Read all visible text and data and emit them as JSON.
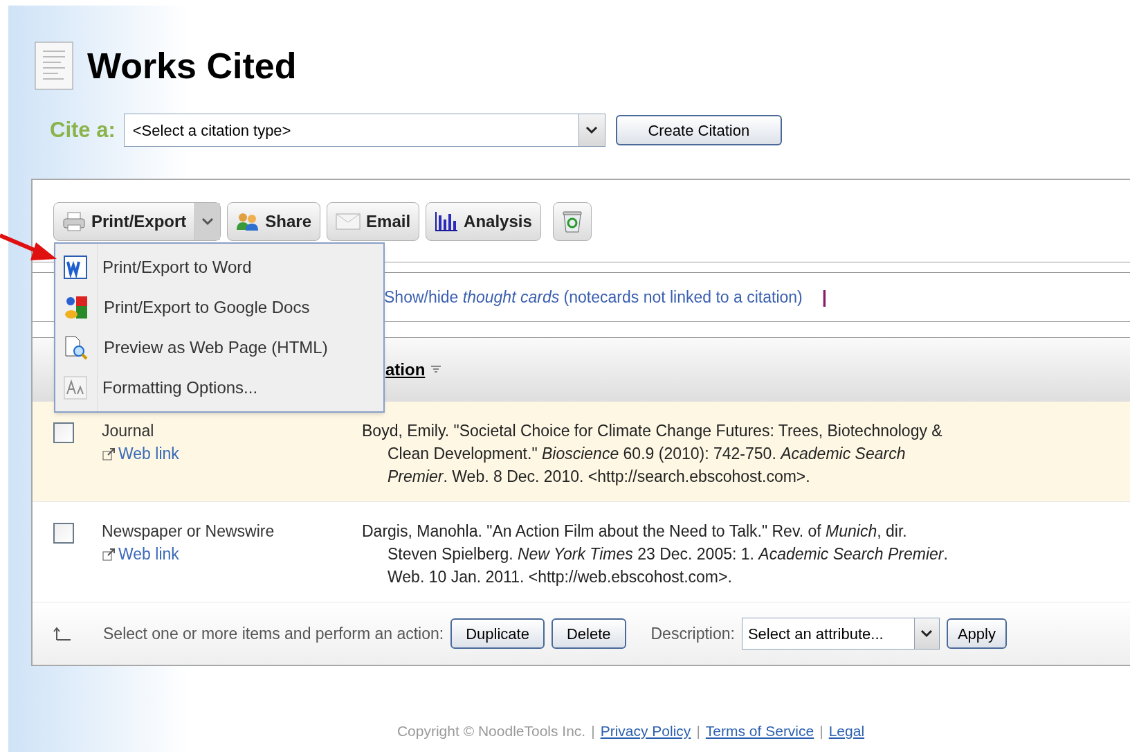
{
  "title": "Works Cited",
  "cite": {
    "label": "Cite a:",
    "select_value": "<Select a citation type>",
    "button": "Create Citation"
  },
  "toolbar": [
    {
      "kind": "split",
      "label": "Print/Export",
      "expanded": true
    },
    {
      "kind": "button",
      "label": "Share"
    },
    {
      "kind": "button",
      "label": "Email"
    },
    {
      "kind": "button",
      "label": "Analysis"
    },
    {
      "kind": "icon"
    }
  ],
  "menu": [
    {
      "label": "Print/Export to Word"
    },
    {
      "label": "Print/Export to Google Docs"
    },
    {
      "label": "Preview as Web Page (HTML)"
    },
    {
      "label": "Formatting Options..."
    }
  ],
  "thought_cards": {
    "link": "Show/hide *thought cards*",
    "note": "(notecards not linked to a citation)",
    "separator": "|"
  },
  "table": {
    "column_2": "ation",
    "rows": [
      {
        "checked": false,
        "highlighted": true,
        "type": "Journal",
        "link": "Web link",
        "citation": [
          "Boyd, Emily. \"Societal Choice for Climate Change Futures: Trees, Biotechnology &",
          "Clean Development.\" *Bioscience* 60.9 (2010): 742-750. *Academic Search*",
          "*Premier*. Web. 8 Dec. 2010. <http://search.ebscohost.com>."
        ]
      },
      {
        "checked": false,
        "highlighted": false,
        "type": "Newspaper or Newswire",
        "link": "Web link",
        "citation": [
          "Dargis, Manohla. \"An Action Film about the Need to Talk.\" Rev. of *Munich*, dir.",
          "Steven Spielberg. *New York Times* 23 Dec. 2005: 1. *Academic Search Premier*.",
          "Web. 10 Jan. 2011. <http://web.ebscohost.com>."
        ]
      }
    ]
  },
  "actions": {
    "hint": "Select one or more items and perform an action:",
    "buttons": [
      "Duplicate",
      "Delete"
    ],
    "description_label": "Description:",
    "description_value": "Select an attribute...",
    "apply": "Apply"
  },
  "footer": {
    "copyright": "Copyright © NoodleTools Inc.",
    "separators": [
      "|",
      "|",
      "|"
    ],
    "links": [
      "Privacy Policy",
      "Terms of Service",
      "Legal"
    ]
  }
}
